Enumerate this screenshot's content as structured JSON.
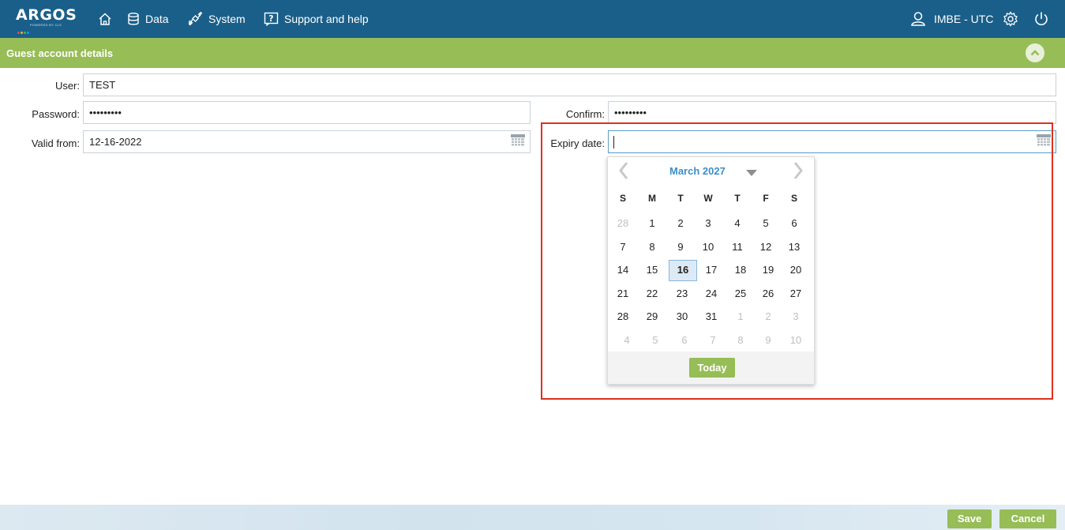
{
  "app": {
    "logo_text": "ARGOS",
    "logo_tagline": "POWERED BY CLS"
  },
  "nav": {
    "home_icon": "home-icon",
    "data_label": "Data",
    "system_label": "System",
    "support_label": "Support and help",
    "user_label": "IMBE - UTC"
  },
  "section": {
    "title": "Guest account details"
  },
  "form": {
    "user_label": "User:",
    "user_value": "TEST",
    "password_label": "Password:",
    "password_value": "•••••••••",
    "confirm_label": "Confirm:",
    "confirm_value": "•••••••••",
    "valid_from_label": "Valid from:",
    "valid_from_value": "12-16-2022",
    "expiry_label": "Expiry date:",
    "expiry_value": ""
  },
  "datepicker": {
    "month_label": "March 2027",
    "weekdays": [
      "S",
      "M",
      "T",
      "W",
      "T",
      "F",
      "S"
    ],
    "weeks": [
      [
        "28",
        "1",
        "2",
        "3",
        "4",
        "5",
        "6"
      ],
      [
        "7",
        "8",
        "9",
        "10",
        "11",
        "12",
        "13"
      ],
      [
        "14",
        "15",
        "16",
        "17",
        "18",
        "19",
        "20"
      ],
      [
        "21",
        "22",
        "23",
        "24",
        "25",
        "26",
        "27"
      ],
      [
        "28",
        "29",
        "30",
        "31",
        "1",
        "2",
        "3"
      ],
      [
        "4",
        "5",
        "6",
        "7",
        "8",
        "9",
        "10"
      ]
    ],
    "selected_day": "16",
    "today_label": "Today"
  },
  "footer": {
    "save_label": "Save",
    "cancel_label": "Cancel"
  },
  "colors": {
    "nav_bg": "#1a5f8a",
    "section_bg": "#96bd56",
    "accent_blue": "#3b8fc8",
    "highlight_red": "#e0301e"
  }
}
